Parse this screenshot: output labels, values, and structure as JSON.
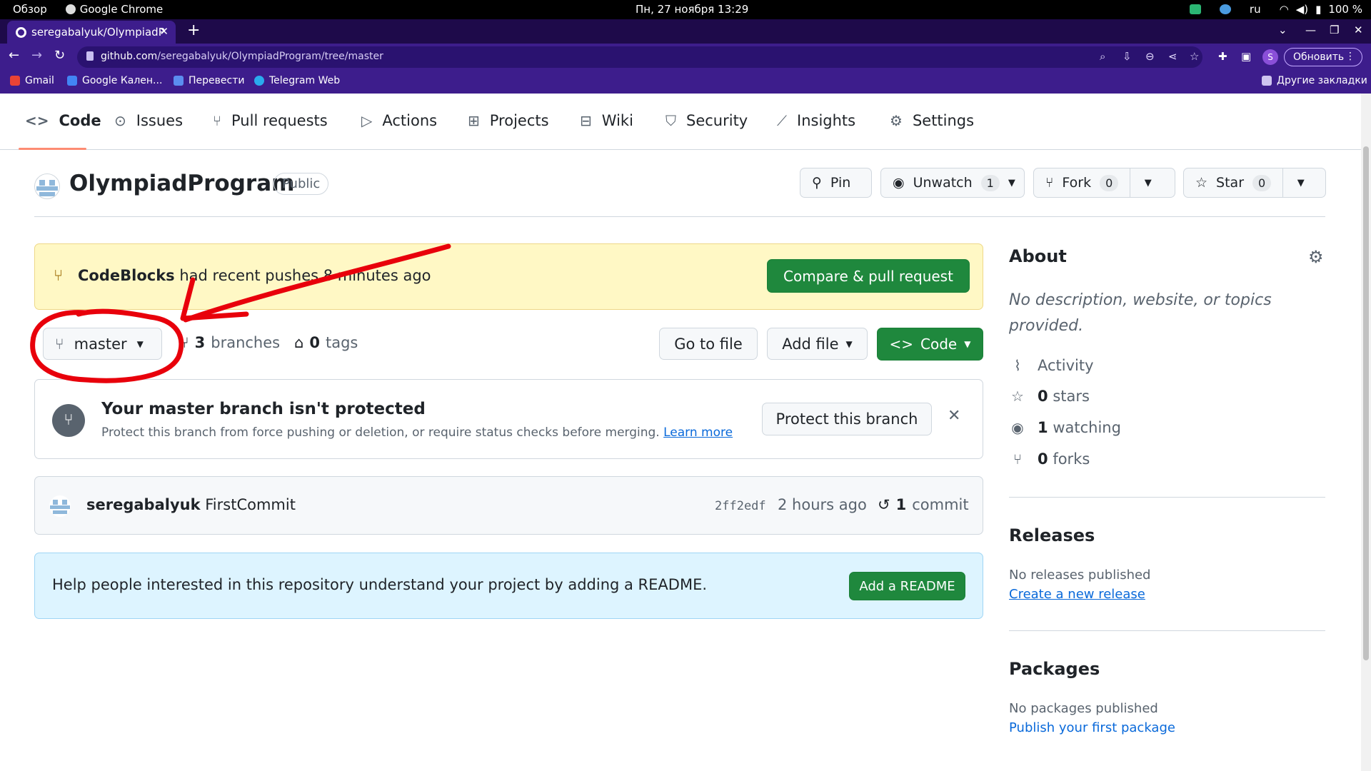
{
  "os": {
    "overview": "Обзор",
    "app": "Google Chrome",
    "clock": "Пн, 27 ноября  13:29",
    "lang": "ru",
    "battery": "100 %"
  },
  "browser": {
    "tab_title": "seregabalyuk/OlympiadP",
    "url_host": "github.com",
    "url_path": "/seregabalyuk/OlympiadProgram/tree/master",
    "profile_initial": "S",
    "update_label": "Обновить",
    "update_menu_icon": "⋮",
    "bookmarks": [
      "Gmail",
      "Google Кален...",
      "Перевести",
      "Telegram Web"
    ],
    "other_bookmarks": "Другие закладки"
  },
  "repo_nav": {
    "tabs": [
      "Code",
      "Issues",
      "Pull requests",
      "Actions",
      "Projects",
      "Wiki",
      "Security",
      "Insights",
      "Settings"
    ]
  },
  "repo": {
    "name": "OlympiadProgram",
    "visibility": "Public",
    "pin": "Pin",
    "unwatch": "Unwatch",
    "watch_count": "1",
    "fork": "Fork",
    "fork_count": "0",
    "star": "Star",
    "star_count": "0"
  },
  "push_banner": {
    "branch": "CodeBlocks",
    "message": " had recent pushes 8 minutes ago",
    "button": "Compare & pull request"
  },
  "branch_bar": {
    "current_branch": "master",
    "branches_count": "3",
    "branches_label": "branches",
    "tags_count": "0",
    "tags_label": "tags",
    "go_to_file": "Go to file",
    "add_file": "Add file",
    "code": "Code"
  },
  "protect": {
    "title": "Your master branch isn't protected",
    "description": "Protect this branch from force pushing or deletion, or require status checks before merging.",
    "learn_more": "Learn more",
    "button": "Protect this branch"
  },
  "commit": {
    "author": "seregabalyuk",
    "message": "FirstCommit",
    "sha": "2ff2edf",
    "time": "2 hours ago",
    "count": "1",
    "count_label": "commit"
  },
  "readme": {
    "text": "Help people interested in this repository understand your project by adding a README.",
    "button": "Add a README"
  },
  "sidebar": {
    "about_title": "About",
    "about_desc": "No description, website, or topics provided.",
    "activity": "Activity",
    "stars_count": "0",
    "stars_label": "stars",
    "watching_count": "1",
    "watching_label": "watching",
    "forks_count": "0",
    "forks_label": "forks",
    "releases_title": "Releases",
    "releases_none": "No releases published",
    "create_release": "Create a new release",
    "packages_title": "Packages",
    "packages_none": "No packages published",
    "publish_package": "Publish your first package"
  },
  "colors": {
    "browser_theme": "#3d1d8c",
    "primary_green": "#1f883d",
    "link_blue": "#0969da",
    "annotation_red": "#e8000b",
    "banner_yellow": "#fff8c5",
    "readme_blue": "#ddf4ff"
  }
}
